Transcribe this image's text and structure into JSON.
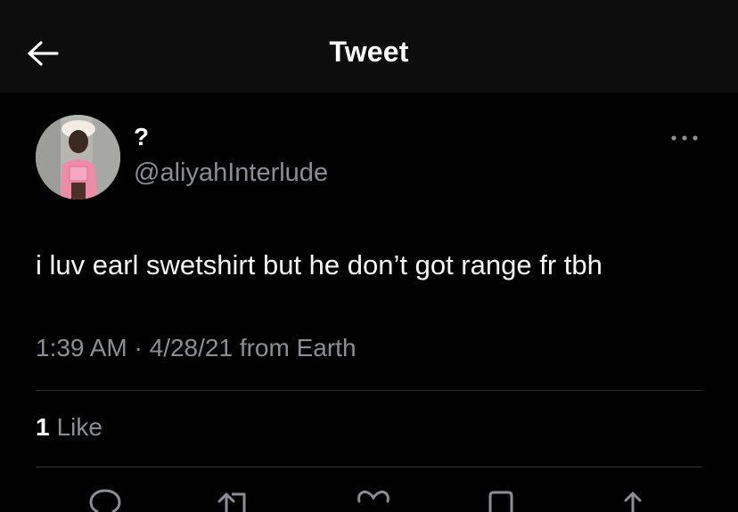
{
  "header": {
    "title": "Tweet",
    "back_icon": "arrow-left-icon"
  },
  "tweet": {
    "author": {
      "display_name": "?",
      "handle": "@aliyahInterlude"
    },
    "text": "i luv earl swetshirt but he don’t got range fr tbh",
    "time": "1:39 AM",
    "separator": "·",
    "date": "4/28/21",
    "source": "from Earth",
    "likes": {
      "count": "1",
      "label": "Like"
    }
  },
  "actions": [
    "reply-icon",
    "retweet-icon",
    "like-icon",
    "bookmark-icon",
    "share-icon"
  ],
  "colors": {
    "background": "#000000",
    "header": "#0d0d0d",
    "text": "#f5f5f5",
    "muted": "#8b8f94",
    "divider": "#2f3336"
  }
}
